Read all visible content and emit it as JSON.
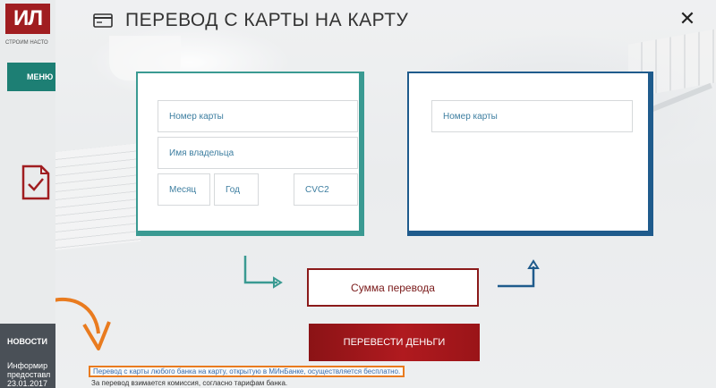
{
  "site": {
    "logo": "ИЛ",
    "tagline": "СТРОИМ НАСТО",
    "menu_label": "МЕНЮ",
    "news_label": "НОВОСТИ",
    "news_lines": [
      "Информир",
      "предоставл",
      "23.01.2017"
    ]
  },
  "modal": {
    "title": "ПЕРЕВОД С КАРТЫ НА КАРТУ",
    "close_label": "✕",
    "from_card": {
      "number_placeholder": "Номер карты",
      "owner_placeholder": "Имя владельца",
      "month_placeholder": "Месяц",
      "year_placeholder": "Год",
      "cvc_placeholder": "CVC2"
    },
    "to_card": {
      "number_placeholder": "Номер карты"
    },
    "amount_placeholder": "Сумма перевода",
    "submit_label": "ПЕРЕВЕСТИ ДЕНЬГИ",
    "notice_highlighted": "Перевод с карты любого банка на карту, открытую в МИнБанке, осуществляется бесплатно.",
    "notice_secondary": "За перевод взимается комиссия, согласно тарифам банка."
  },
  "colors": {
    "accent_teal": "#3a9a92",
    "accent_blue": "#1f5b8c",
    "brand_red": "#a01d20",
    "highlight_orange": "#e97b1f"
  }
}
